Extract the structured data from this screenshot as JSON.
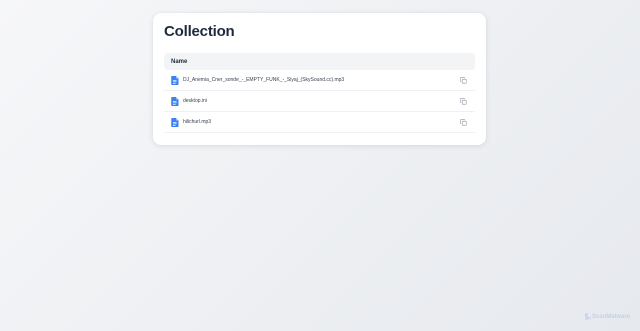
{
  "collection": {
    "title": "Collection",
    "column_header": "Name",
    "files": [
      {
        "name": "DJ_Anemia_Cner_sonde_-_EMPTY_FUNK_-_Siyaj_(SkySound.cc).mp3",
        "icon": "file-document-icon"
      },
      {
        "name": "desktop.ini",
        "icon": "file-document-icon"
      },
      {
        "name": "hilichurl.mp3",
        "icon": "file-document-icon"
      }
    ],
    "copy_icon": "copy-icon"
  },
  "watermark": {
    "text": "ScanMalware",
    "icon": "scanmalware-logo-icon"
  },
  "colors": {
    "file_icon": "#3b82f6",
    "copy_icon": "#9ca3af",
    "watermark": "#c5d2e3"
  }
}
